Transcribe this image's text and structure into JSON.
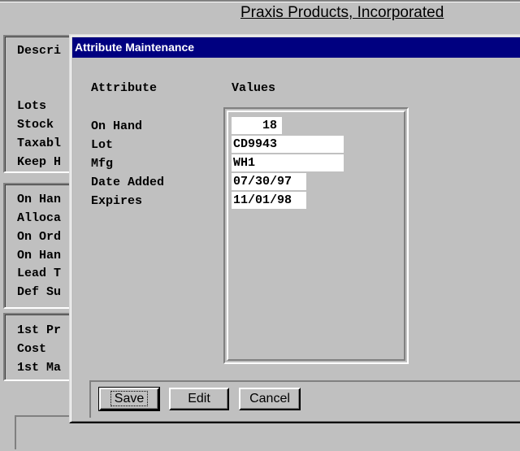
{
  "app": {
    "company": "Praxis Products, Incorporated"
  },
  "background": {
    "panel1": [
      "Descri",
      "Lots",
      "Stock",
      "Taxabl",
      "Keep H"
    ],
    "panel2": [
      "On Han",
      "Alloca",
      "On Ord",
      "On Han",
      "Lead T",
      "Def Su"
    ],
    "panel3": [
      "1st Pr",
      "Cost",
      "1st Ma"
    ]
  },
  "dialog": {
    "title": "Attribute Maintenance",
    "attribute_header": "Attribute",
    "values_header": "Values",
    "rows": [
      {
        "attribute": "On Hand",
        "value": "    18"
      },
      {
        "attribute": "Lot",
        "value": "CD9943"
      },
      {
        "attribute": "Mfg",
        "value": "WH1"
      },
      {
        "attribute": "Date Added",
        "value": "07/30/97"
      },
      {
        "attribute": "Expires",
        "value": "11/01/98"
      }
    ],
    "buttons": {
      "save": "Save",
      "edit": "Edit",
      "cancel": "Cancel"
    }
  }
}
